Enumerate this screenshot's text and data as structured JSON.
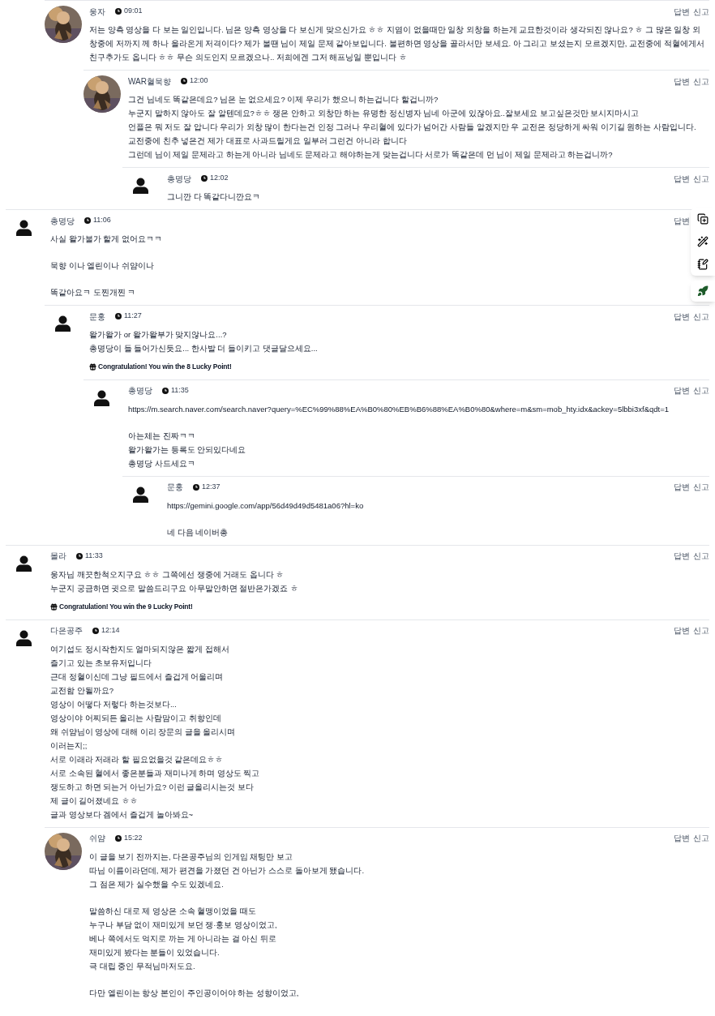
{
  "threads": [
    {
      "children": [
        {
          "author": "웅자",
          "time": "09:01",
          "avatar": {
            "kind": "picture"
          },
          "actions": [
            "답변",
            "신고"
          ],
          "paragraphs": [
            [
              "저는 양측 영상을 다 보는 일인입니다. 님은 양측 영상을 다 보신게 맞으신가요 ㅎㅎ 지염이 없을때만 일창 외창을 하는게 교묘한것이라 생각되진 않나요? ㅎ 그 많은 일창 외창중에 저까지 께 하나 올라온게 저격이다? 제가 볼땐 님이 제일 문제 같아보입니다. 불편하면 영상을 골라서만 보세요. 아 그리고 보셨는지 모르겠지만, 교전중에 적혈에게서 친구추가도 옵니다 ㅎㅎ 무슨 의도인지 모르겠으나.. 저희에겐 그저 해프닝일 뿐입니다 ㅎ"
            ]
          ],
          "children": [
            {
              "author": "WAR혈묵향",
              "time": "12:00",
              "avatar": {
                "kind": "picture"
              },
              "actions": [
                "답변",
                "신고"
              ],
              "paragraphs": [
                [
                  "그건 님네도 똑같은데요?  님은 눈 없으세요? 이제 우리가 했으니 하는겁니다 할겁니까?",
                  "누군지 말하지 않아도 잘 알텐데요?ㅎㅎ 쟁은 안하고 외창만 하는 유명한 정신병자 님네 아군에 있잖아요..잘보세요 보고싶은것만 보시지마시고",
                  "언플은 뭐 저도 잘 압니다 우리가 외창 많이 한다는건 인정 그러나 우리혈에 있다가 넘어간 사람들 알겠지만 우 교전은 정당하게 싸워 이기길 원하는 사람입니다. 교전중에 친추 넣은건 제가 대표로 사과드릴게요 일부러 그런건 아니라 합니다",
                  "그런데 님이 제일 문제라고 하는게 아니라 님네도 문제라고 해야하는게 맞는겁니다 서로가 똑같은데 먼 님이 제일 문제라고 하는겁니까?"
                ]
              ],
              "children": [
                {
                  "author": "총명당",
                  "time": "12:02",
                  "avatar": {
                    "kind": "default"
                  },
                  "actions": [
                    "답변",
                    "신고"
                  ],
                  "paragraphs": [
                    [
                      "그니깐 다 똑같다니깐요ㅋ"
                    ]
                  ]
                }
              ]
            }
          ]
        }
      ]
    },
    {
      "author": "총명당",
      "time": "11:06",
      "avatar": {
        "kind": "default"
      },
      "actions": [
        "답변"
      ],
      "paragraphs": [
        [
          "사실 왈가불가 할게 없어요ㅋㅋ"
        ],
        [
          "묵향 이나 엘린이나 쉬얌이나"
        ],
        [
          "똑같아요ㅋ 도찐개찐 ㅋ"
        ]
      ],
      "children": [
        {
          "author": "문홍",
          "time": "11:27",
          "avatar": {
            "kind": "default"
          },
          "actions": [
            "답변",
            "신고"
          ],
          "paragraphs": [
            [
              "왈가왈가 or 왈가왈부가 맞지않나요...?",
              "총명당이 들 들어가신듯요... 한사발 더 들이키고 댓글달으세요..."
            ]
          ],
          "lucky": "Congratulation! You win the **8** Lucky Point!",
          "children": [
            {
              "author": "총명당",
              "time": "11:35",
              "avatar": {
                "kind": "default"
              },
              "actions": [
                "답변",
                "신고"
              ],
              "paragraphs": [
                [
                  "https://m.search.naver.com/search.naver?query=%EC%99%88%EA%B0%80%EB%B6%88%EA%B0%80&where=m&sm=mob_hty.idx&ackey=5lbbi3xf&qdt=1"
                ],
                [
                  "아는체는 진짜ㅋㅋ",
                  "왈가왈가는 등록도 안되있다네요",
                  "총명당 사드세요ㅋ"
                ]
              ],
              "children": [
                {
                  "author": "문홍",
                  "time": "12:37",
                  "avatar": {
                    "kind": "default"
                  },
                  "actions": [
                    "답변",
                    "신고"
                  ],
                  "paragraphs": [
                    [
                      "https://gemini.google.com/app/56d49d49d5481a06?hl=ko"
                    ],
                    [
                      "네 다음 네이버총"
                    ]
                  ]
                }
              ]
            }
          ]
        }
      ]
    },
    {
      "author": "몰라",
      "time": "11:33",
      "avatar": {
        "kind": "default"
      },
      "actions": [
        "답변",
        "신고"
      ],
      "paragraphs": [
        [
          "웅자님   깨끗한척오지구요 ㅎㅎ 그쪽에선 쟁중에 거래도 옵니다 ㅎ",
          "누군지 궁금하면 귓으로 말씀드리구요 아무말안하면 절반은가겠죠 ㅎ"
        ]
      ],
      "lucky": "Congratulation! You win the **9** Lucky Point!"
    },
    {
      "author": "다은공주",
      "time": "12:14",
      "avatar": {
        "kind": "default"
      },
      "actions": [
        "답변",
        "신고"
      ],
      "paragraphs": [
        [
          "여기섭도 정시작한지도 얼마되지않은 짧게 접해서",
          "즐기고 있는 초보유저입니다",
          "근대 정혈이신데 그냥 필드에서 즐겁게 어울리며",
          "교전함 안될까요?",
          "영상이 어떻다 저렇다 하는것보다...",
          "영상이야 어찌되든 올리는 사람맘이고 취향인데",
          "왜 쉬얌님이 영상에 대해 이리 장문의 글을 올리시며",
          "이러는지;;",
          "서로 이래라 저래라 할 필요없을것 같은데요ㅎㅎ",
          "서로 소속된 혈에서 좋은분들과 재미나게 하며 영상도 찍고",
          "쟁도하고 하면 되는거 아닌가요? 이런 글올리시는것 보다",
          "제 글이 길어졌네요 ㅎㅎ",
          "글과 영상보다 겜에서 즐겁게 놀아봐요~"
        ]
      ],
      "children": [
        {
          "author": "쉬얌",
          "time": "15:22",
          "avatar": {
            "kind": "picture"
          },
          "actions": [
            "답변",
            "신고"
          ],
          "paragraphs": [
            [
              "이 글을 보기 전까지는, 다은공주님의 인게임 채팅만 보고",
              "따님 이름이라던데, 제가 편견을 가졌던 건 아닌가 스스로 돌아보게 됐습니다.",
              "그 점은 제가 실수했을 수도 있겠네요."
            ],
            [
              "말씀하신 대로 제 영상은 소속 혈맹이었을 때도",
              "누구나 부담 없이 재미있게 보던 쟁·홍보 영상이었고,",
              "베나 쪽에서도 억지로 까는 게 아니라는 걸 아신 뒤로",
              "재미있게 봤다는 분들이 있었습니다.",
              "극 대립 중인 무적님마저도요."
            ],
            [
              "다만 엘린이는 항상 본인이 주인공이어야 하는 성향이었고,"
            ]
          ]
        }
      ]
    }
  ]
}
